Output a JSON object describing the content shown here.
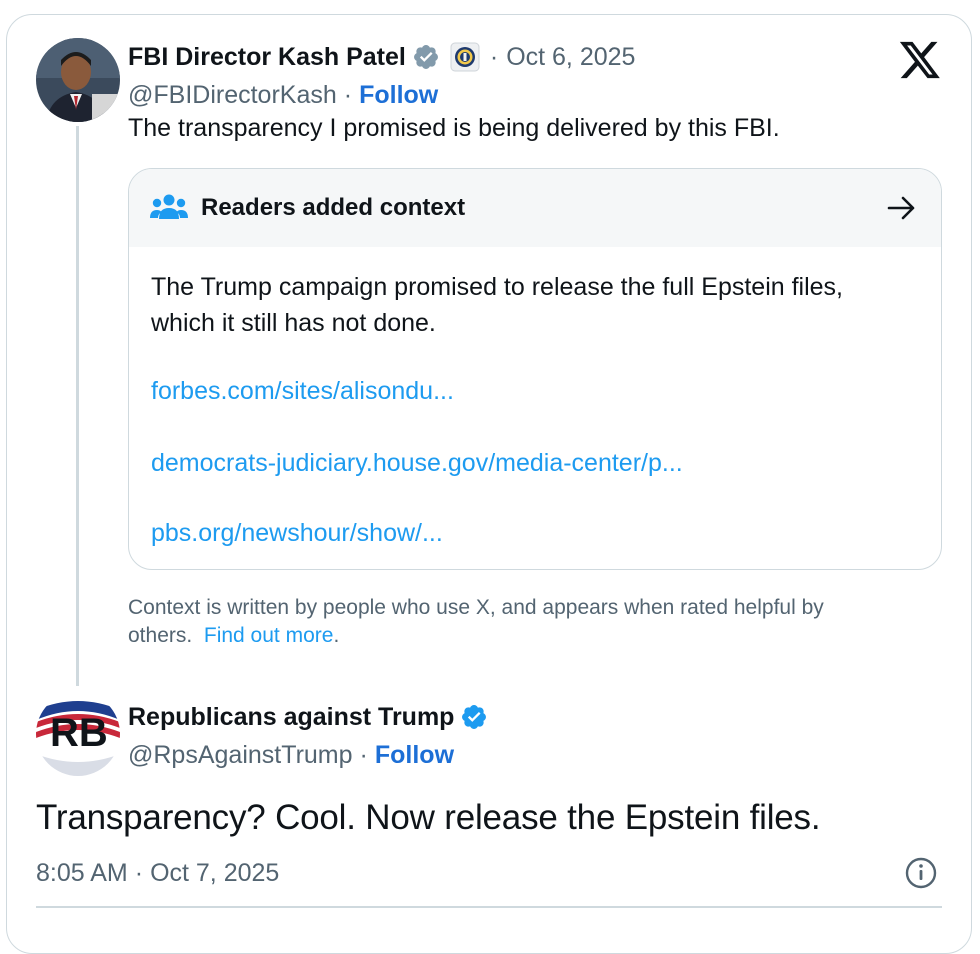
{
  "tweet1": {
    "author_name": "FBI Director Kash Patel",
    "handle": "@FBIDirectorKash",
    "follow_label": "Follow",
    "separator": "·",
    "date": "Oct 6, 2025",
    "text": "The transparency I promised is being delivered by this FBI."
  },
  "community_note": {
    "title": "Readers added context",
    "body_line1": "The Trump campaign promised to release the full Epstein files,",
    "body_line2": "which it still has not done.",
    "links": [
      "forbes.com/sites/alisondu...",
      "democrats-judiciary.house.gov/media-center/p...",
      "pbs.org/newshour/show/..."
    ],
    "disclaimer_line1": "Context is written by people who use X, and appears when rated helpful by",
    "disclaimer_line2": "others.",
    "find_out_more": "Find out more",
    "period": "."
  },
  "tweet2": {
    "author_name": "Republicans against Trump",
    "handle": "@RpsAgainstTrump",
    "follow_label": "Follow",
    "separator": "·",
    "avatar_letters": "RB",
    "text": "Transparency? Cool. Now release the Epstein files.",
    "time": "8:05 AM",
    "date": "Oct 7, 2025"
  },
  "icons": {
    "verified": "verified-badge-icon",
    "fbi_seal": "fbi-seal-icon",
    "x_logo": "x-logo-icon",
    "people": "people-icon",
    "arrow": "arrow-right-icon",
    "info": "info-icon"
  },
  "colors": {
    "link_blue": "#1d9bf0",
    "follow_blue": "#1d6fd6",
    "verified_gray": "#829aab",
    "verified_blue": "#1d9bf0",
    "text": "#0f1419",
    "muted": "#536471",
    "border": "#cfd9de"
  }
}
